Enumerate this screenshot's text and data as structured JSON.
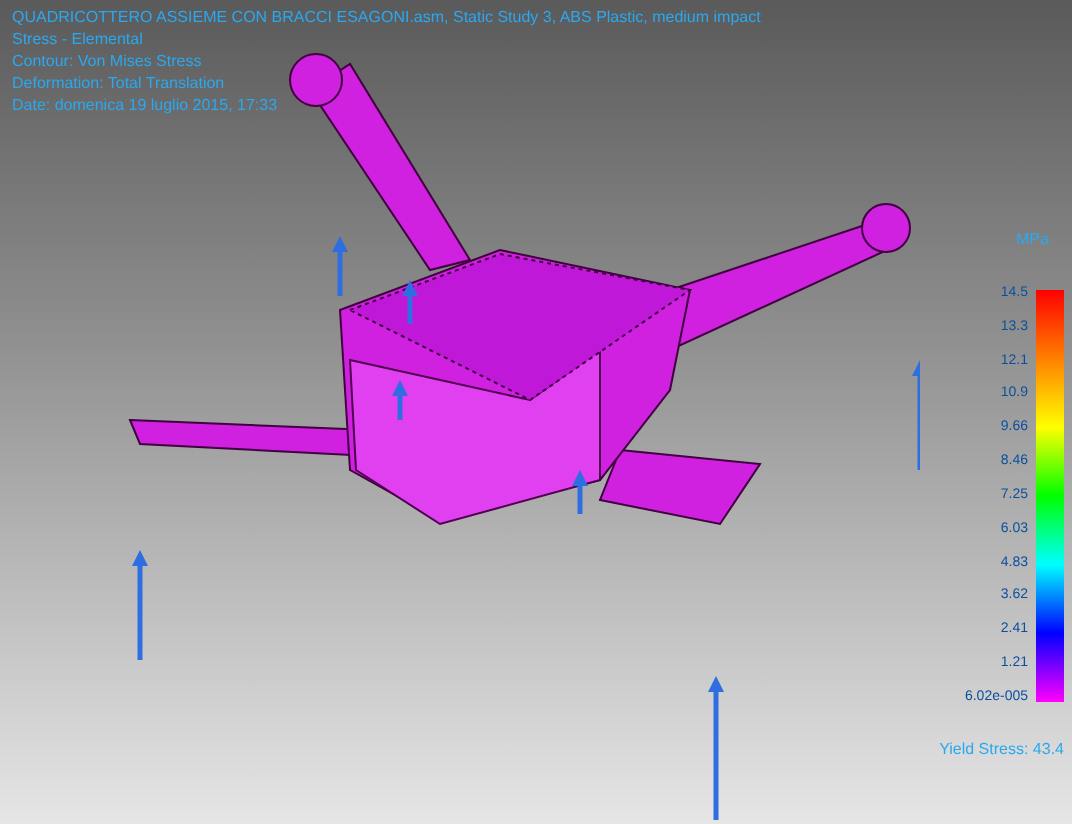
{
  "header": {
    "lines": [
      "QUADRICOTTERO ASSIEME CON BRACCI ESAGONI.asm, Static Study 3, ABS Plastic, medium impact",
      "Stress - Elemental",
      "Contour: Von Mises Stress",
      "Deformation: Total Translation",
      "Date: domenica 19 luglio 2015, 17:33"
    ]
  },
  "legend": {
    "unit": "MPa",
    "ticks": [
      "14.5",
      "13.3",
      "12.1",
      "10.9",
      "9.66",
      "8.46",
      "7.25",
      "6.03",
      "4.83",
      "3.62",
      "2.41",
      "1.21",
      "6.02e-005"
    ],
    "yield_label": "Yield Stress: 43.4"
  }
}
